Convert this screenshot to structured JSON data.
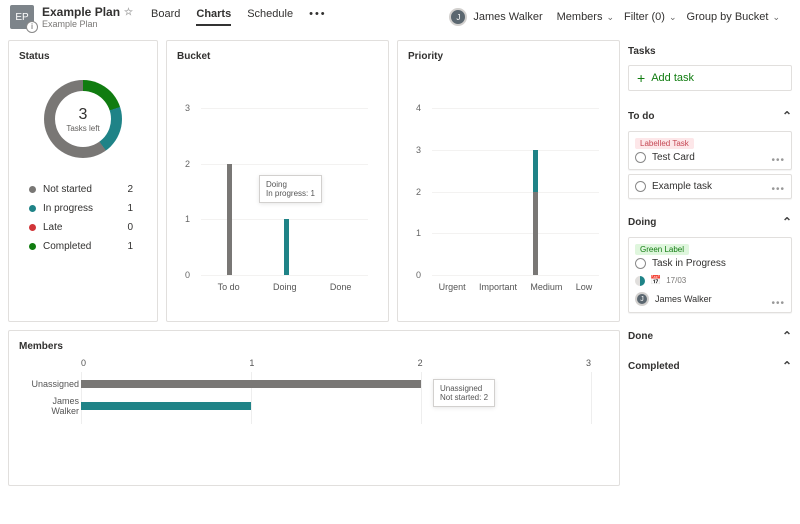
{
  "header": {
    "plan_icon_text": "EP",
    "title": "Example Plan",
    "subtitle": "Example Plan",
    "nav": {
      "board": "Board",
      "charts": "Charts",
      "schedule": "Schedule"
    },
    "user_name": "James Walker",
    "members_label": "Members",
    "filter_label": "Filter (0)",
    "group_label": "Group by Bucket"
  },
  "status_card": {
    "title": "Status",
    "center_number": "3",
    "center_label": "Tasks left",
    "legend": [
      {
        "label": "Not started",
        "value": "2",
        "color": "#797775"
      },
      {
        "label": "In progress",
        "value": "1",
        "color": "#1f8387"
      },
      {
        "label": "Late",
        "value": "0",
        "color": "#d13438"
      },
      {
        "label": "Completed",
        "value": "1",
        "color": "#107c10"
      }
    ]
  },
  "bucket_card": {
    "title": "Bucket",
    "tooltip_line1": "Doing",
    "tooltip_line2": "In progress: 1"
  },
  "priority_card": {
    "title": "Priority"
  },
  "members_card": {
    "title": "Members",
    "tooltip_line1": "Unassigned",
    "tooltip_line2": "Not started: 2"
  },
  "panel": {
    "tasks_title": "Tasks",
    "add_label": "Add task",
    "sections": {
      "todo": "To do",
      "doing": "Doing",
      "done": "Done",
      "completed": "Completed"
    },
    "todo": [
      {
        "badge": "Labelled Task",
        "badge_class": "red",
        "title": "Test Card"
      },
      {
        "title": "Example task"
      }
    ],
    "doing": {
      "badge": "Green Label",
      "badge_class": "green",
      "title": "Task in Progress",
      "date": "17/03",
      "assignee": "James Walker"
    }
  },
  "chart_data": [
    {
      "type": "bar",
      "name": "Bucket",
      "categories": [
        "To do",
        "Doing",
        "Done"
      ],
      "series": [
        {
          "name": "Not started",
          "values": [
            2,
            0,
            0
          ],
          "color": "#797775"
        },
        {
          "name": "In progress",
          "values": [
            0,
            1,
            0
          ],
          "color": "#1f8387"
        }
      ],
      "yticks": [
        0,
        1,
        2,
        3
      ],
      "ylim": [
        0,
        3
      ]
    },
    {
      "type": "bar",
      "name": "Priority",
      "categories": [
        "Urgent",
        "Important",
        "Medium",
        "Low"
      ],
      "series": [
        {
          "name": "Not started",
          "values": [
            0,
            0,
            2,
            0
          ],
          "color": "#797775"
        },
        {
          "name": "In progress",
          "values": [
            0,
            0,
            1,
            0
          ],
          "color": "#1f8387"
        }
      ],
      "yticks": [
        0,
        1,
        2,
        3,
        4
      ],
      "ylim": [
        0,
        4
      ]
    },
    {
      "type": "bar",
      "name": "Members",
      "orientation": "horizontal",
      "categories": [
        "Unassigned",
        "James Walker"
      ],
      "series": [
        {
          "name": "Not started",
          "values": [
            2,
            0
          ],
          "color": "#797775"
        },
        {
          "name": "In progress",
          "values": [
            0,
            1
          ],
          "color": "#1f8387"
        }
      ],
      "xticks": [
        0,
        1,
        2,
        3
      ],
      "xlim": [
        0,
        3
      ]
    },
    {
      "type": "pie",
      "name": "Status",
      "categories": [
        "Not started",
        "In progress",
        "Late",
        "Completed"
      ],
      "values": [
        2,
        1,
        0,
        1
      ]
    }
  ]
}
